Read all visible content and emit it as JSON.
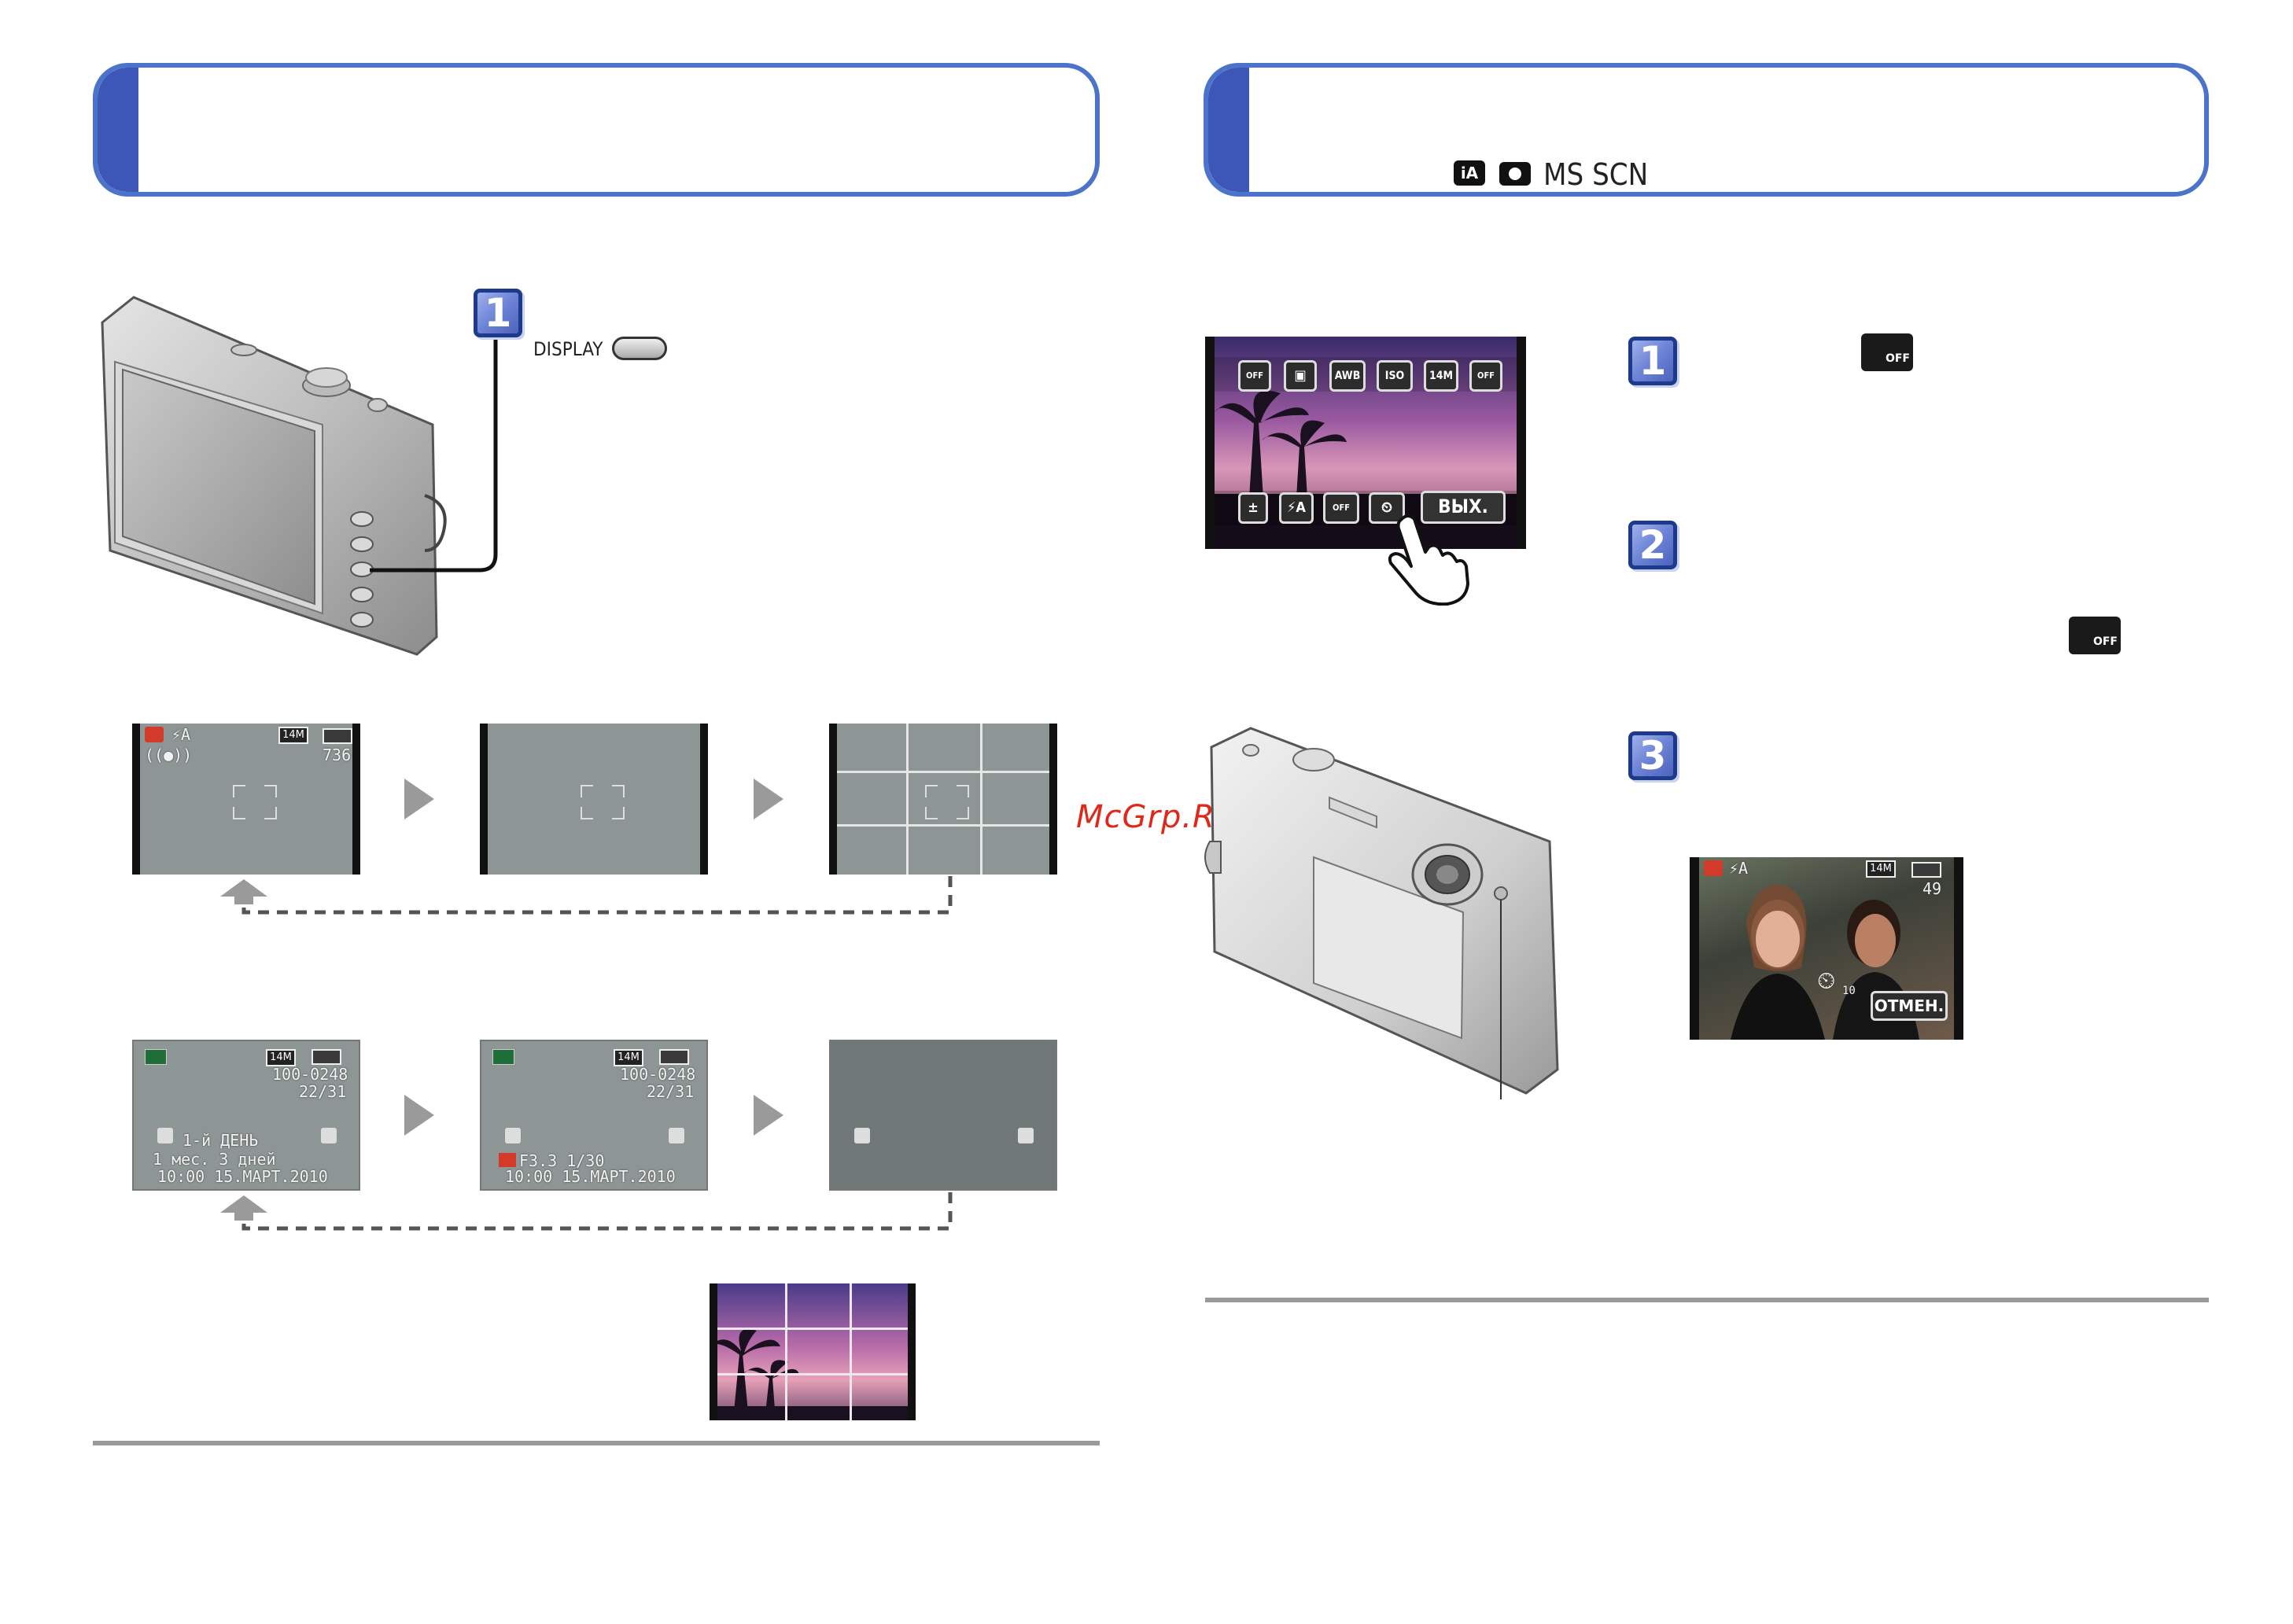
{
  "left_page": {
    "display_button_label": "DISPLAY",
    "step_number": "1",
    "recording_screen": {
      "battery_count": "736",
      "size_label": "14M"
    },
    "playback_screen": {
      "file_no": "100-0248",
      "frame": "22/31",
      "size_label": "14M",
      "travel_day": "1-й ДЕНЬ",
      "age": "1 мес.  3 дней",
      "datetime": "10:00  15.МАРТ.2010",
      "exposure": "F3.3 1/30"
    }
  },
  "right_page": {
    "mode_icons": [
      "iA",
      "camera",
      "MS",
      "SCN"
    ],
    "mode_text": "MS  SCN",
    "menu_top_icons": [
      "OFF",
      "▣",
      "AWB",
      "ISO",
      "14M",
      "OFF"
    ],
    "menu_bottom_icons": [
      "±",
      "⚡A",
      "OFF",
      "⏲",
      "ВЫХ."
    ],
    "exit_label": "ВЫХ.",
    "step_numbers": [
      "1",
      "2",
      "3"
    ],
    "countdown_screen": {
      "size_label": "14M",
      "remaining": "49",
      "timer_value": "10",
      "cancel_label": "ОТМЕН."
    }
  },
  "watermark": "McGrp.Ru"
}
